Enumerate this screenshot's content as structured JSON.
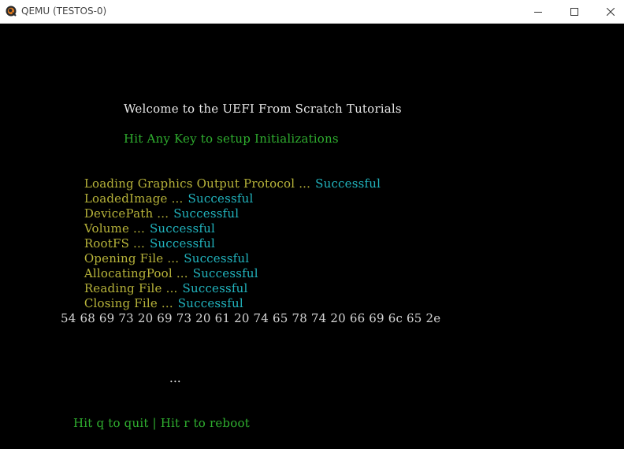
{
  "window": {
    "title": "QEMU (TESTOS-0)",
    "icon": "qemu-icon",
    "controls": {
      "minimize": "minimize-icon",
      "maximize": "maximize-icon",
      "close": "close-icon"
    }
  },
  "console": {
    "welcome": "Welcome to the UEFI From Scratch Tutorials",
    "prompt": "Hit Any Key to setup Initializations",
    "steps": [
      {
        "label": "Loading Graphics Output Protocol ...",
        "status": "Successful"
      },
      {
        "label": "LoadedImage ...",
        "status": "Successful"
      },
      {
        "label": "DevicePath ...",
        "status": "Successful"
      },
      {
        "label": "Volume ...",
        "status": "Successful"
      },
      {
        "label": "RootFS ...",
        "status": "Successful"
      },
      {
        "label": "Opening File ...",
        "status": "Successful"
      },
      {
        "label": "AllocatingPool ...",
        "status": "Successful"
      },
      {
        "label": "Reading File ...",
        "status": "Successful"
      },
      {
        "label": "Closing File ...",
        "status": "Successful"
      }
    ],
    "hex_dump": "54 68 69 73 20 69 73 20 61 20 74 65 78 74 20 66 69 6c 65 2e",
    "ellipsis": "...",
    "footer": "Hit q to quit | Hit r to reboot"
  },
  "colors": {
    "background": "#000000",
    "welcome": "#e8e8e8",
    "prompt": "#2fae2f",
    "step_label": "#b8b43a",
    "step_status": "#21b3bd",
    "hex": "#d4d4d4",
    "footer": "#2fae2f"
  }
}
